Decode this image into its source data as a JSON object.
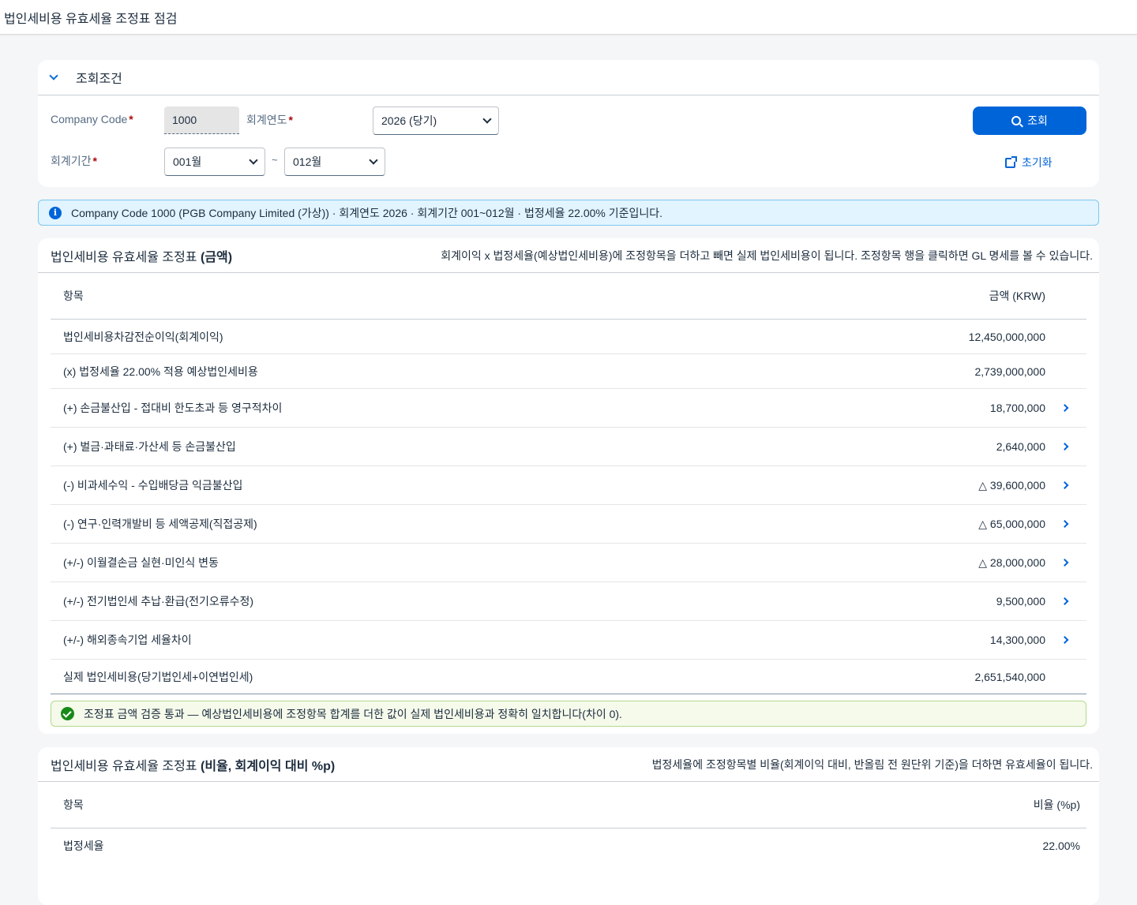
{
  "page": {
    "title": "법인세비용 유효세율 조정표 점검"
  },
  "filter": {
    "section_label": "조회조건",
    "company_code_label": "Company Code",
    "company_code_value": "1000",
    "fiscal_year_label": "회계연도",
    "fiscal_year_value": "2026 (당기)",
    "period_label": "회계기간",
    "period_from": "001월",
    "period_to": "012월",
    "tilde": "~",
    "required_mark": "*",
    "search_button": "조회",
    "reset_button": "초기화"
  },
  "info": {
    "text": "Company Code 1000 (PGB Company Limited (가상)) · 회계연도 2026 · 회계기간 001~012월 · 법정세율 22.00% 기준입니다."
  },
  "amount_table": {
    "title_prefix": "법인세비용 유효세율 조정표 ",
    "title_bold": "(금액)",
    "description": "회계이익 x 법정세율(예상법인세비용)에 조정항목을 더하고 빼면 실제 법인세비용이 됩니다. 조정항목 행을 클릭하면 GL 명세를 볼 수 있습니다.",
    "col_item": "항목",
    "col_amount": "금액 (KRW)",
    "rows": [
      {
        "label": "법인세비용차감전순이익(회계이익)",
        "amount": "12,450,000,000"
      },
      {
        "label": "(x) 법정세율 22.00% 적용 예상법인세비용",
        "amount": "2,739,000,000"
      },
      {
        "label": "(+) 손금불산입 - 접대비 한도초과 등 영구적차이",
        "amount": "18,700,000"
      },
      {
        "label": "(+) 벌금·과태료·가산세 등 손금불산입",
        "amount": "2,640,000"
      },
      {
        "label": "(-) 비과세수익 - 수입배당금 익금불산입",
        "amount": "△ 39,600,000"
      },
      {
        "label": "(-) 연구·인력개발비 등 세액공제(직접공제)",
        "amount": "△ 65,000,000"
      },
      {
        "label": "(+/-) 이월결손금 실현·미인식 변동",
        "amount": "△ 28,000,000"
      },
      {
        "label": "(+/-) 전기법인세 추납·환급(전기오류수정)",
        "amount": "9,500,000"
      },
      {
        "label": "(+/-) 해외종속기업 세율차이",
        "amount": "14,300,000"
      },
      {
        "label": "실제 법인세비용(당기법인세+이연법인세)",
        "amount": "2,651,540,000"
      }
    ],
    "validation": "조정표 금액 검증 통과 — 예상법인세비용에 조정항목 합계를 더한 값이 실제 법인세비용과 정확히 일치합니다(차이 0)."
  },
  "ratio_table": {
    "title_prefix": "법인세비용 유효세율 조정표 ",
    "title_bold": "(비율, 회계이익 대비 %p)",
    "description": "법정세율에 조정항목별 비율(회계이익 대비, 반올림 전 원단위 기준)을 더하면 유효세율이 됩니다.",
    "col_item": "항목",
    "col_ratio": "비율 (%p)",
    "rows": [
      {
        "label": "법정세율",
        "ratio": "22.00%"
      }
    ]
  }
}
